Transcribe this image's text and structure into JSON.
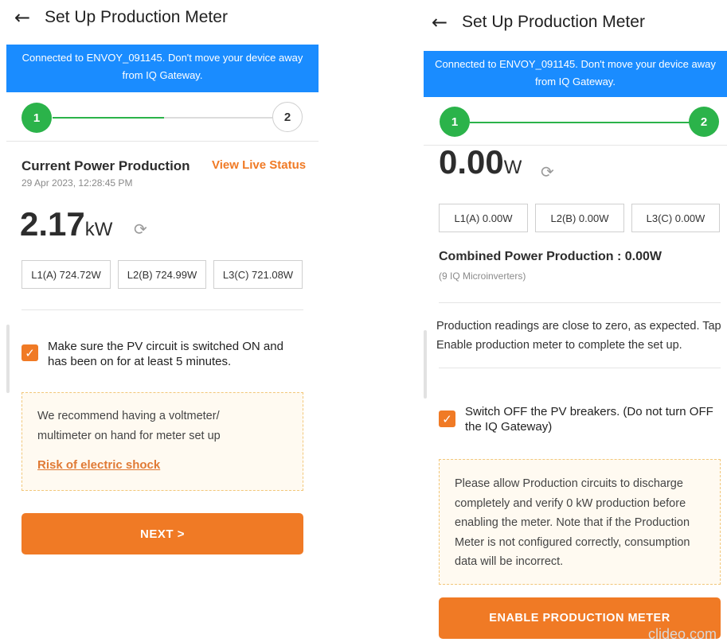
{
  "left": {
    "header": {
      "title": "Set Up Production Meter"
    },
    "banner": {
      "text": "Connected to ENVOY_091145. Don't move your device away from IQ Gateway."
    },
    "stepper": {
      "step1": "1",
      "step2": "2"
    },
    "section": {
      "title": "Current Power Production",
      "timestamp": "29 Apr 2023, 12:28:45 PM",
      "live_link": "View Live Status"
    },
    "power": {
      "value": "2.17",
      "unit": "kW"
    },
    "phases": [
      "L1(A) 724.72W",
      "L2(B) 724.99W",
      "L3(C) 721.08W"
    ],
    "checklist": {
      "label": "Make sure the PV circuit is switched ON and has been on for at least 5 minutes.",
      "checked": true
    },
    "notice": {
      "text": "We recommend having a voltmeter/ multimeter on hand for meter set up",
      "link": "Risk of electric shock"
    },
    "next_button": "NEXT >"
  },
  "right": {
    "header": {
      "title": "Set Up Production Meter"
    },
    "banner": {
      "text": "Connected to ENVOY_091145. Don't move your device away from IQ Gateway."
    },
    "stepper": {
      "step1": "1",
      "step2": "2"
    },
    "power": {
      "value": "0.00",
      "unit": "W"
    },
    "phases": [
      "L1(A) 0.00W",
      "L2(B) 0.00W",
      "L3(C) 0.00W"
    ],
    "combined": {
      "title": "Combined Power Production : 0.00W",
      "sub": "(9 IQ Microinverters)"
    },
    "reading_note": "Production readings are close to zero, as expected. Tap Enable production meter to complete the set up.",
    "checklist": {
      "label": "Switch OFF the PV breakers. (Do not turn OFF the IQ Gateway)",
      "checked": true
    },
    "notice": {
      "text": "Please allow Production circuits to discharge completely and verify 0 kW production before enabling the meter. Note that if the Production Meter is not configured correctly, consumption data will be incorrect."
    },
    "enable_button": "ENABLE PRODUCTION METER",
    "watermark": "clideo.com"
  },
  "colors": {
    "banner": "#1a8cff",
    "accent": "#f07a25",
    "success": "#2bb34a"
  },
  "icons": {
    "back": "back-arrow-icon",
    "refresh": "refresh-icon",
    "check": "checkmark-icon"
  }
}
